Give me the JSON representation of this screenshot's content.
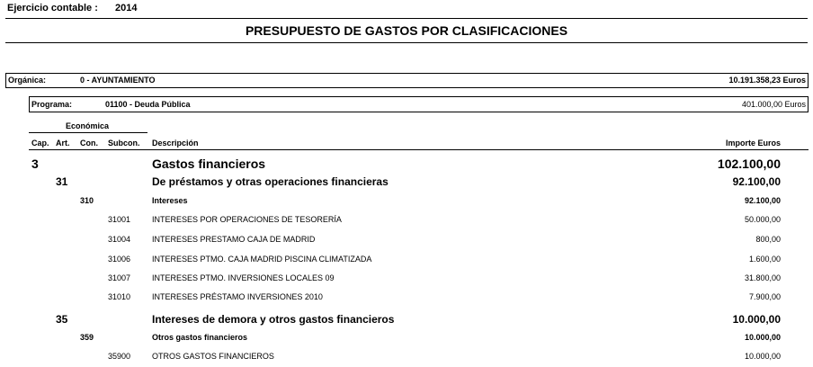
{
  "header": {
    "fiscal_year_label": "Ejercicio contable :",
    "fiscal_year": "2014",
    "title": "PRESUPUESTO DE GASTOS POR CLASIFICACIONES"
  },
  "organica": {
    "label": "Orgánica:",
    "value": "0 - AYUNTAMIENTO",
    "amount": "10.191.358,23 Euros"
  },
  "programa": {
    "label": "Programa:",
    "value": "01100 - Deuda Pública",
    "amount": "401.000,00 Euros"
  },
  "columns": {
    "group": "Económica",
    "cap": "Cap.",
    "art": "Art.",
    "con": "Con.",
    "subcon": "Subcon.",
    "description": "Descripción",
    "amount": "Importe Euros"
  },
  "rows": [
    {
      "level": "cap",
      "code": "3",
      "description": "Gastos financieros",
      "amount": "102.100,00"
    },
    {
      "level": "art",
      "code": "31",
      "description": "De préstamos y otras operaciones financieras",
      "amount": "92.100,00"
    },
    {
      "level": "con",
      "code": "310",
      "description": "Intereses",
      "amount": "92.100,00"
    },
    {
      "level": "sub",
      "code": "31001",
      "description": "INTERESES POR OPERACIONES DE TESORERÍA",
      "amount": "50.000,00"
    },
    {
      "level": "sub",
      "code": "31004",
      "description": "INTERESES PRESTAMO CAJA DE MADRID",
      "amount": "800,00"
    },
    {
      "level": "sub",
      "code": "31006",
      "description": "INTERESES PTMO. CAJA MADRID PISCINA CLIMATIZADA",
      "amount": "1.600,00"
    },
    {
      "level": "sub",
      "code": "31007",
      "description": "INTERESES PTMO. INVERSIONES LOCALES 09",
      "amount": "31.800,00"
    },
    {
      "level": "sub",
      "code": "31010",
      "description": "INTERESES PRÉSTAMO INVERSIONES 2010",
      "amount": "7.900,00"
    },
    {
      "level": "art",
      "code": "35",
      "description": "Intereses de demora y otros gastos financieros",
      "amount": "10.000,00"
    },
    {
      "level": "con",
      "code": "359",
      "description": "Otros gastos financieros",
      "amount": "10.000,00"
    },
    {
      "level": "sub",
      "code": "35900",
      "description": "OTROS GASTOS FINANCIEROS",
      "amount": "10.000,00"
    }
  ]
}
